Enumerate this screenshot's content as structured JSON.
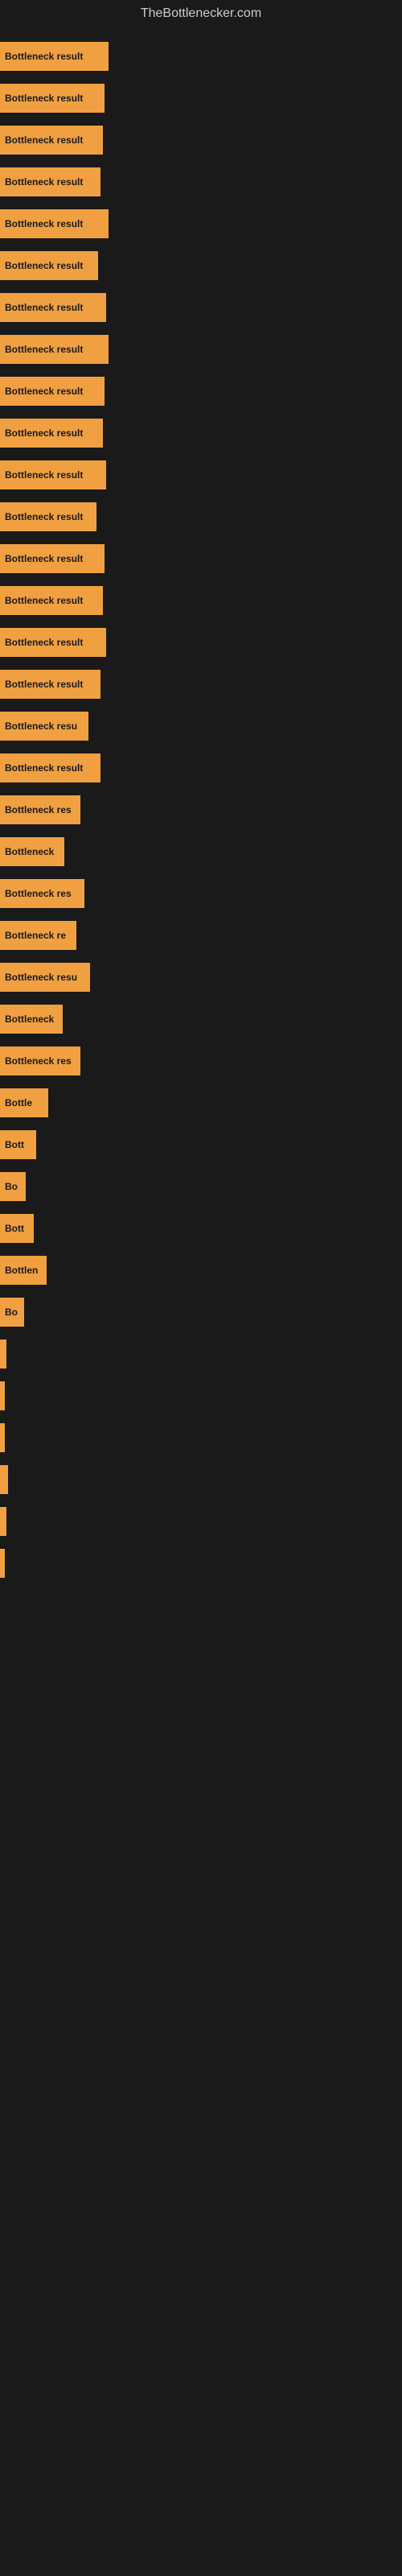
{
  "site": {
    "title": "TheBottlenecker.com"
  },
  "bars": [
    {
      "label": "Bottleneck result",
      "width": 135
    },
    {
      "label": "Bottleneck result",
      "width": 130
    },
    {
      "label": "Bottleneck result",
      "width": 128
    },
    {
      "label": "Bottleneck result",
      "width": 125
    },
    {
      "label": "Bottleneck result",
      "width": 135
    },
    {
      "label": "Bottleneck result",
      "width": 122
    },
    {
      "label": "Bottleneck result",
      "width": 132
    },
    {
      "label": "Bottleneck result",
      "width": 135
    },
    {
      "label": "Bottleneck result",
      "width": 130
    },
    {
      "label": "Bottleneck result",
      "width": 128
    },
    {
      "label": "Bottleneck result",
      "width": 132
    },
    {
      "label": "Bottleneck result",
      "width": 120
    },
    {
      "label": "Bottleneck result",
      "width": 130
    },
    {
      "label": "Bottleneck result",
      "width": 128
    },
    {
      "label": "Bottleneck result",
      "width": 132
    },
    {
      "label": "Bottleneck result",
      "width": 125
    },
    {
      "label": "Bottleneck resu",
      "width": 110
    },
    {
      "label": "Bottleneck result",
      "width": 125
    },
    {
      "label": "Bottleneck res",
      "width": 100
    },
    {
      "label": "Bottleneck",
      "width": 80
    },
    {
      "label": "Bottleneck res",
      "width": 105
    },
    {
      "label": "Bottleneck re",
      "width": 95
    },
    {
      "label": "Bottleneck resu",
      "width": 112
    },
    {
      "label": "Bottleneck",
      "width": 78
    },
    {
      "label": "Bottleneck res",
      "width": 100
    },
    {
      "label": "Bottle",
      "width": 60
    },
    {
      "label": "Bott",
      "width": 45
    },
    {
      "label": "Bo",
      "width": 32
    },
    {
      "label": "Bott",
      "width": 42
    },
    {
      "label": "Bottlen",
      "width": 58
    },
    {
      "label": "Bo",
      "width": 30
    },
    {
      "label": "",
      "width": 8
    },
    {
      "label": "",
      "width": 6
    },
    {
      "label": "",
      "width": 5
    },
    {
      "label": "",
      "width": 10
    },
    {
      "label": "",
      "width": 8
    },
    {
      "label": "",
      "width": 6
    }
  ]
}
